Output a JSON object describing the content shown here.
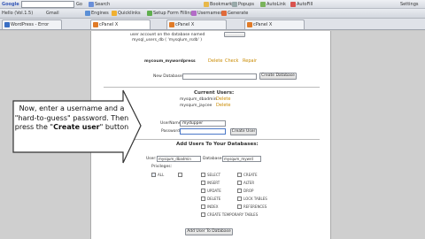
{
  "browser": {
    "row1": {
      "brand": "Google",
      "go_label": "Go",
      "search_label": "Search",
      "bookmarks_label": "Bookmarks",
      "popups_label": "Popups",
      "autolink_label": "AutoLink",
      "autofill_label": "AutoFill",
      "settings_label": "Settings"
    },
    "row2": {
      "bookmark1": "Hello (Vol.1.5)",
      "bookmark2": "Gmail",
      "engine": "Engines",
      "quick": "Quicklinks",
      "setup": "Setup Form Filling",
      "toolbar1": "Usernames",
      "toolbar2": "Generate"
    },
    "tabs": [
      "WordPress - Error",
      "cPanel X",
      "cPanel X",
      "cPanel X"
    ]
  },
  "mysql": {
    "intro_line1": "user account on the database named",
    "intro_line2": "mysql_users_db ( 'mysqlum_rsdb' )",
    "db_name": "mycoum_mywordpress",
    "db_actions": [
      "Delete",
      "Check",
      "Repair"
    ],
    "new_db_label": "New Database:",
    "create_db_button": "Create Database",
    "current_users_title": "Current Users:",
    "current_users": [
      {
        "name": "mysqum_dbadmin",
        "action": "Delete"
      },
      {
        "name": "mysqum_jaycee",
        "action": "Delete"
      }
    ],
    "username_label": "UserName:",
    "username_value": "mydupper",
    "password_label": "Password:",
    "create_user_button": "Create User",
    "add_users_title": "Add Users To Your Databases:",
    "user_select_label": "User:",
    "user_select_value": "mysqum_dbadmin",
    "db_select_label": "Database:",
    "db_select_value": "mysqum_mywrd",
    "privileges_label": "Privileges:",
    "all_label": "ALL",
    "privileges_col1": [
      "SELECT",
      "INSERT",
      "UPDATE",
      "DELETE",
      "INDEX",
      "CREATE TEMPORARY TABLES"
    ],
    "privileges_col2": [
      "CREATE",
      "ALTER",
      "DROP",
      "LOCK TABLES",
      "REFERENCES"
    ],
    "add_user_button": "Add User To Database"
  },
  "callout": {
    "line1": "Now, enter a username and a",
    "line2": "\"hard-to-guess\" password. Then",
    "line3_prefix": "press the \"",
    "line3_bold": "Create user",
    "line3_suffix": "\" button"
  },
  "colors": {
    "link": "#c98a00",
    "callout_fill": "#ffffff",
    "callout_border": "#333333"
  }
}
